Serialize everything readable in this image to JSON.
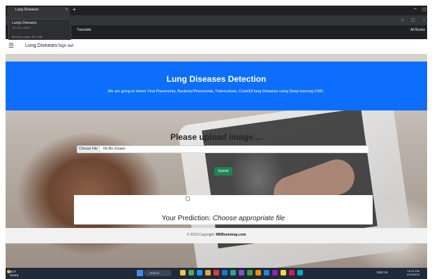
{
  "browser": {
    "tab_title": "Lung Diseases",
    "new_tab": "+",
    "tab_close": "×",
    "url": "turbo",
    "bookmark": "Translate",
    "all_bookmarks": "All Books",
    "popup_title": "Lungs Diseases",
    "popup_subtitle": "127.0.0.1:5000",
    "popup_memory": "Memory usage: 80.2 MB"
  },
  "nav": {
    "brand": "Lung Diseases",
    "signout": "Sign out"
  },
  "hero": {
    "title": "Lung Diseases Detection",
    "description": "We are going to detect Viral Pneumonia, Bacterial Pneumonia, Tuberculosis, Covid19 lung Diseases using Deep learning-CNN ."
  },
  "upload": {
    "title": "Please upload image....",
    "file_button": "Choose File",
    "file_status": "No file chosen",
    "submit": "Submit"
  },
  "prediction": {
    "label": "Your Prediction: ",
    "value": "Choose appropriate file"
  },
  "footer": {
    "copyright": "© 2023 Copyright: ",
    "link": "MDBootstrap.com"
  },
  "taskbar": {
    "weather_temp": "46°F",
    "weather_desc": "Sunny",
    "search": "Search",
    "tray": "ENG  IN",
    "time": "10:01 PM",
    "date": "4/29/2023"
  },
  "colors": {
    "hero_bg": "#0d6efd",
    "submit_bg": "#198754",
    "taskbar_bg": "#1f2a3a"
  }
}
